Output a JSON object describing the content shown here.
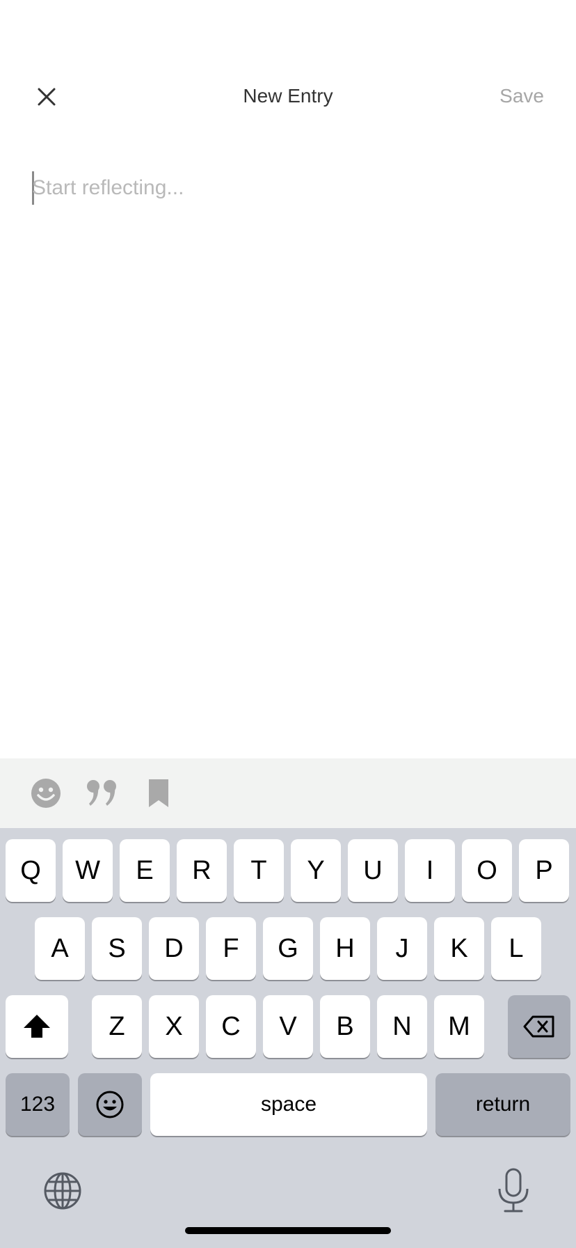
{
  "header": {
    "title": "New Entry",
    "save_label": "Save"
  },
  "editor": {
    "placeholder": "Start reflecting...",
    "value": ""
  },
  "accessory": {
    "icons": [
      "smiley-icon",
      "quote-icon",
      "bookmark-icon"
    ]
  },
  "keyboard": {
    "row1": [
      "Q",
      "W",
      "E",
      "R",
      "T",
      "Y",
      "U",
      "I",
      "O",
      "P"
    ],
    "row2": [
      "A",
      "S",
      "D",
      "F",
      "G",
      "H",
      "J",
      "K",
      "L"
    ],
    "row3": [
      "Z",
      "X",
      "C",
      "V",
      "B",
      "N",
      "M"
    ],
    "numbers_label": "123",
    "space_label": "space",
    "return_label": "return"
  },
  "colors": {
    "accent_gray": "#a6a6a6",
    "keyboard_bg": "#d1d4db",
    "accessory_bg": "#f2f3f2"
  }
}
